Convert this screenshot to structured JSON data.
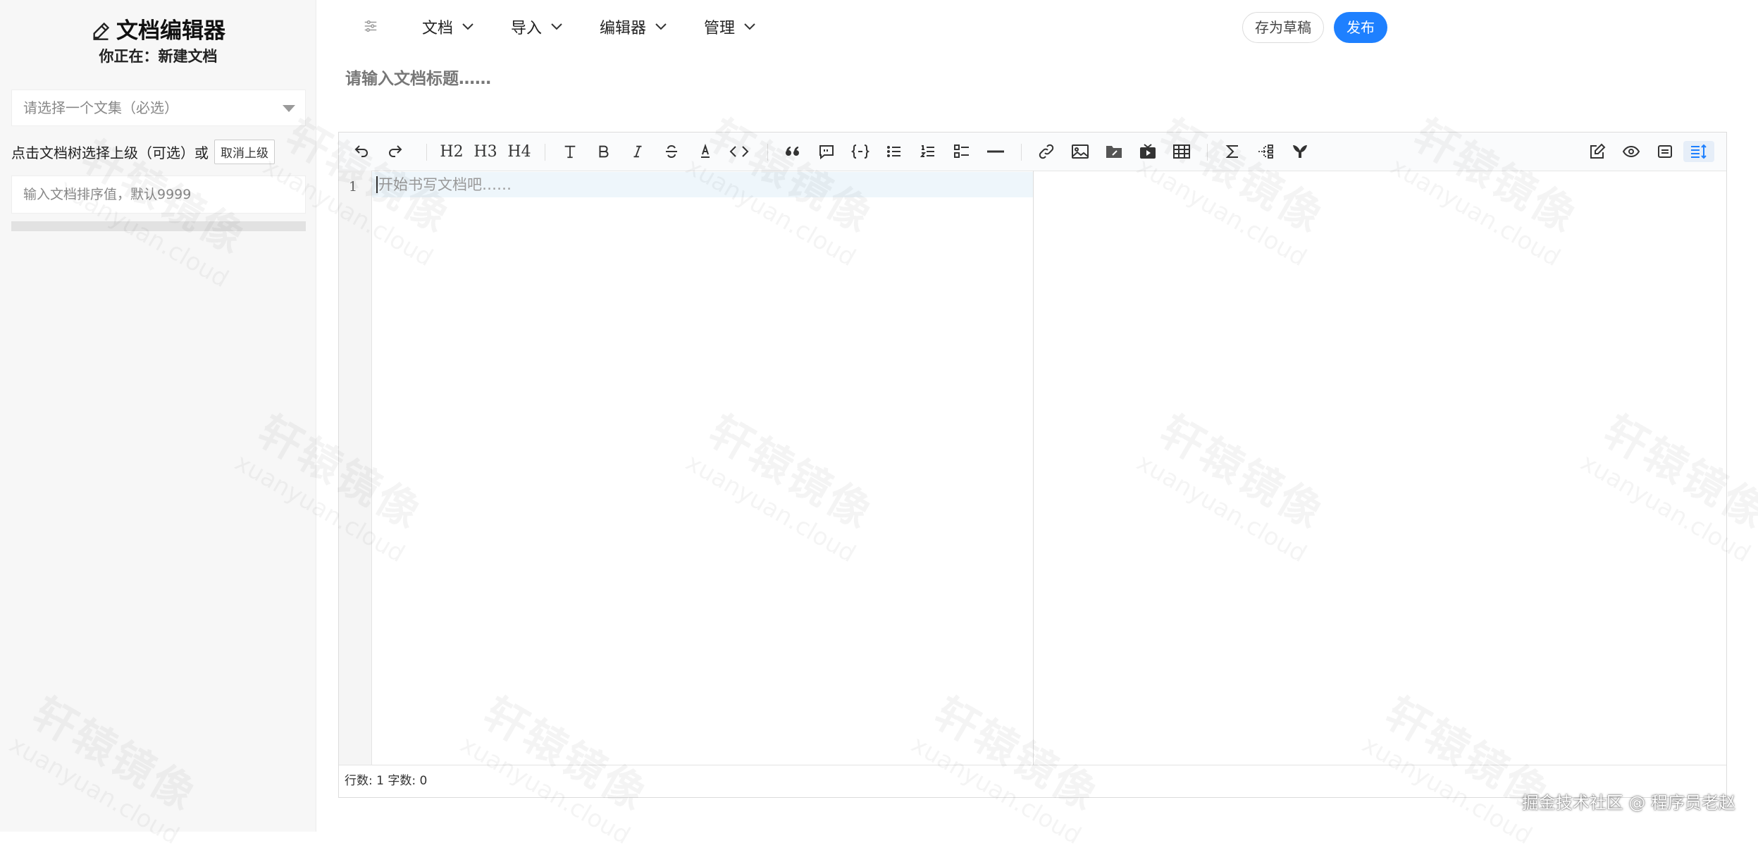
{
  "sidebar": {
    "brand_title": "文档编辑器",
    "subtitle": "你正在：新建文档",
    "collection_placeholder": "请选择一个文集（必选）",
    "parent_hint": "点击文档树选择上级（可选）或",
    "cancel_parent_label": "取消上级",
    "order_placeholder": "输入文档排序值，默认9999"
  },
  "header": {
    "menus": [
      "文档",
      "导入",
      "编辑器",
      "管理"
    ],
    "draft_label": "存为草稿",
    "publish_label": "发布"
  },
  "title_placeholder": "请输入文档标题……",
  "editor": {
    "toolbar_icons": [
      "undo-icon",
      "redo-icon",
      "h2-icon",
      "h3-icon",
      "h4-icon",
      "text-size-icon",
      "bold-icon",
      "italic-icon",
      "strikethrough-icon",
      "font-color-icon",
      "inline-code-icon",
      "quote-icon",
      "comment-icon",
      "code-block-icon",
      "bullet-list-icon",
      "ordered-list-icon",
      "checklist-icon",
      "horizontal-rule-icon",
      "link-icon",
      "image-icon",
      "attachment-icon",
      "video-icon",
      "table-icon",
      "formula-icon",
      "mindmap-icon",
      "mermaid-icon",
      "edit-mode-icon",
      "preview-icon",
      "preview-only-icon",
      "sync-scroll-icon"
    ],
    "h2_label": "H2",
    "h3_label": "H3",
    "h4_label": "H4",
    "line_number": "1",
    "content_placeholder": "开始书写文档吧……",
    "status_text": "行数: 1 字数: 0"
  },
  "watermark": {
    "cn": "轩辕镜像",
    "en": "xuanyuan.cloud"
  },
  "credit": "掘金技术社区 @ 程序员老赵",
  "colors": {
    "primary": "#1e80ff",
    "sidebar_bg": "#f7f7f7"
  }
}
